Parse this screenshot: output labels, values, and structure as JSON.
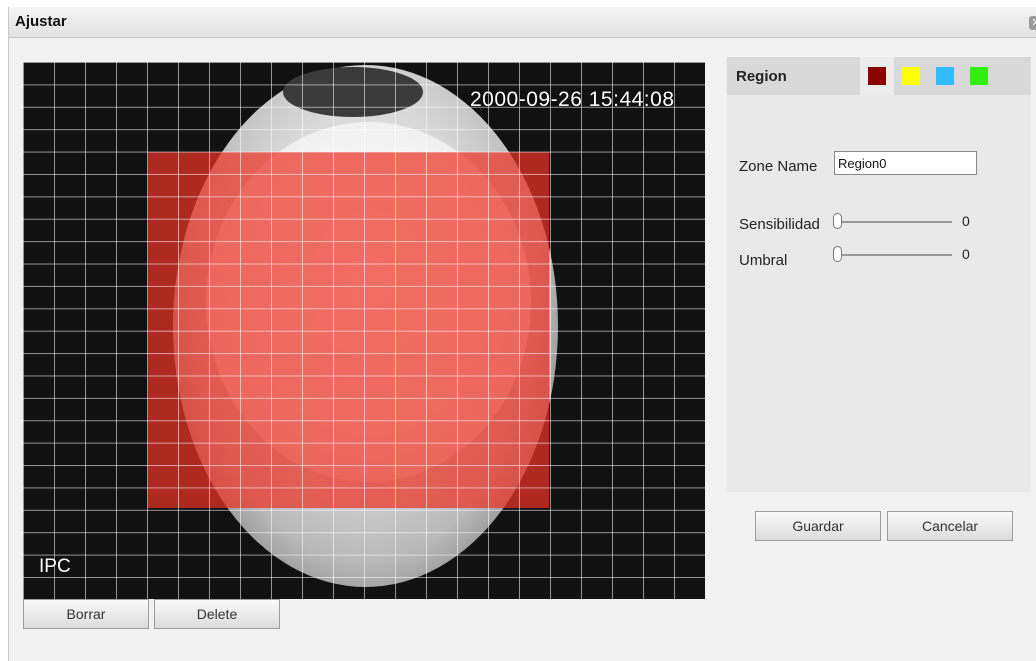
{
  "dialog": {
    "title": "Ajustar",
    "close_icon": "close-icon"
  },
  "video": {
    "timestamp": "2000-09-26 15:44:08",
    "channel_label": "IPC"
  },
  "buttons": {
    "borrar": "Borrar",
    "delete": "Delete",
    "guardar": "Guardar",
    "cancelar": "Cancelar"
  },
  "region_panel": {
    "title": "Region",
    "colors": [
      {
        "name": "dark-red",
        "hex": "#8b0000",
        "selected": true
      },
      {
        "name": "yellow",
        "hex": "#ffff00",
        "selected": false
      },
      {
        "name": "blue",
        "hex": "#33bbff",
        "selected": false
      },
      {
        "name": "green",
        "hex": "#33ee11",
        "selected": false
      }
    ],
    "zone_name_label": "Zone Name",
    "zone_name_value": "Region0",
    "sensitivity": {
      "label": "Sensibilidad",
      "value": "0"
    },
    "threshold": {
      "label": "Umbral",
      "value": "0"
    }
  },
  "colors": {
    "zone_overlay": "#ec3428",
    "panel_bg": "#e9e9e9"
  }
}
